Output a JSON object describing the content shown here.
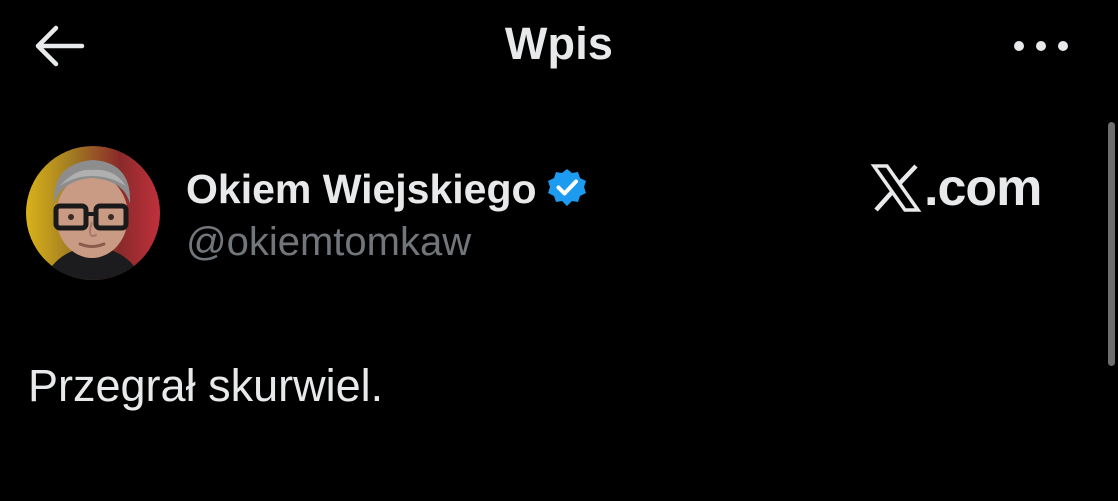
{
  "header": {
    "title": "Wpis",
    "back_icon": "arrow-left-icon",
    "more_icon": "more-horizontal-icon"
  },
  "author": {
    "display_name": "Okiem Wiejskiego",
    "handle": "@okiemtomkaw",
    "verified": true,
    "verified_icon": "verified-badge-icon",
    "verified_color": "#1d9bf0"
  },
  "watermark": {
    "logo_icon": "x-logo-icon",
    "domain_suffix": ".com"
  },
  "post": {
    "text": "Przegrał skurwiel."
  },
  "colors": {
    "background": "#000000",
    "primary_text": "#e7e9ea",
    "secondary_text": "#71767b",
    "accent": "#1d9bf0"
  }
}
